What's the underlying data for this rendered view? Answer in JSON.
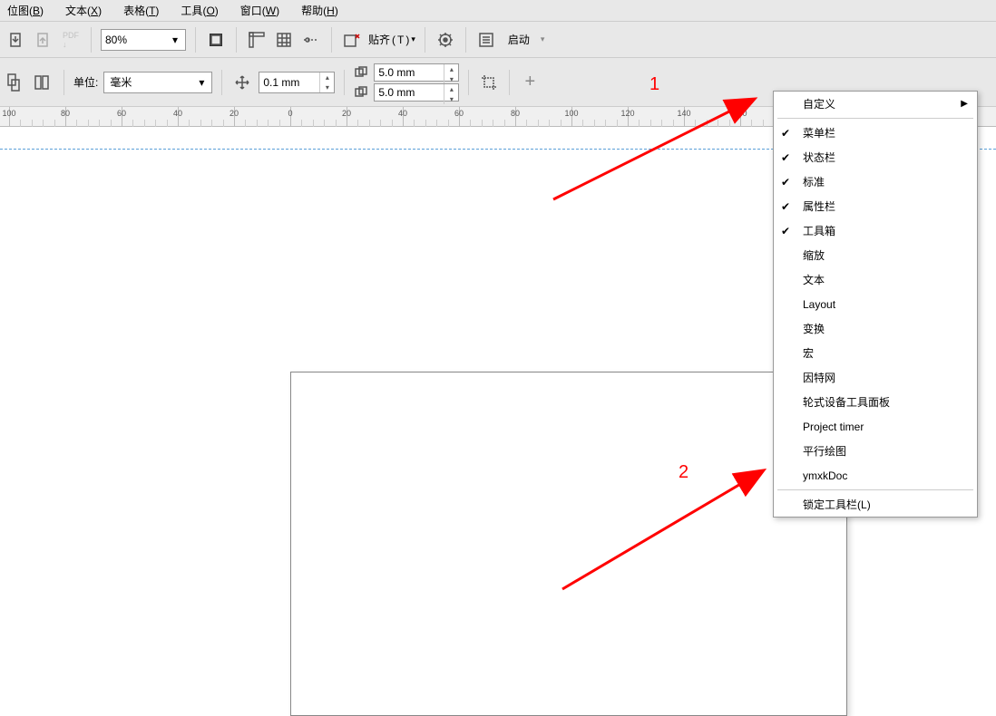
{
  "menubar": {
    "items": [
      {
        "label": "位图",
        "key": "B"
      },
      {
        "label": "文本",
        "key": "X"
      },
      {
        "label": "表格",
        "key": "T"
      },
      {
        "label": "工具",
        "key": "O"
      },
      {
        "label": "窗口",
        "key": "W"
      },
      {
        "label": "帮助",
        "key": "H"
      }
    ]
  },
  "toolbar1": {
    "zoom": "80%",
    "snap_label": "贴齐",
    "snap_key": "T",
    "launch_label": "启动"
  },
  "toolbar2": {
    "unit_label": "单位:",
    "unit_value": "毫米",
    "nudge_value": "0.1 mm",
    "dup_x": "5.0 mm",
    "dup_y": "5.0 mm"
  },
  "ruler": {
    "labels": [
      "100",
      "80",
      "60",
      "40",
      "20",
      "0",
      "20",
      "40",
      "60",
      "80",
      "100",
      "120",
      "140",
      "160"
    ]
  },
  "context_menu": {
    "customize": "自定义",
    "items": [
      {
        "label": "菜单栏",
        "checked": true
      },
      {
        "label": "状态栏",
        "checked": true
      },
      {
        "label": "标准",
        "checked": true
      },
      {
        "label": "属性栏",
        "checked": true
      },
      {
        "label": "工具箱",
        "checked": true
      },
      {
        "label": "缩放",
        "checked": false
      },
      {
        "label": "文本",
        "checked": false
      },
      {
        "label": "Layout",
        "checked": false
      },
      {
        "label": "变换",
        "checked": false
      },
      {
        "label": "宏",
        "checked": false
      },
      {
        "label": "因特网",
        "checked": false
      },
      {
        "label": "轮式设备工具面板",
        "checked": false
      },
      {
        "label": "Project timer",
        "checked": false
      },
      {
        "label": "平行绘图",
        "checked": false
      },
      {
        "label": "ymxkDoc",
        "checked": false
      }
    ],
    "lock": {
      "label": "锁定工具栏",
      "key": "L"
    }
  },
  "annotations": {
    "n1": "1",
    "n2": "2"
  }
}
